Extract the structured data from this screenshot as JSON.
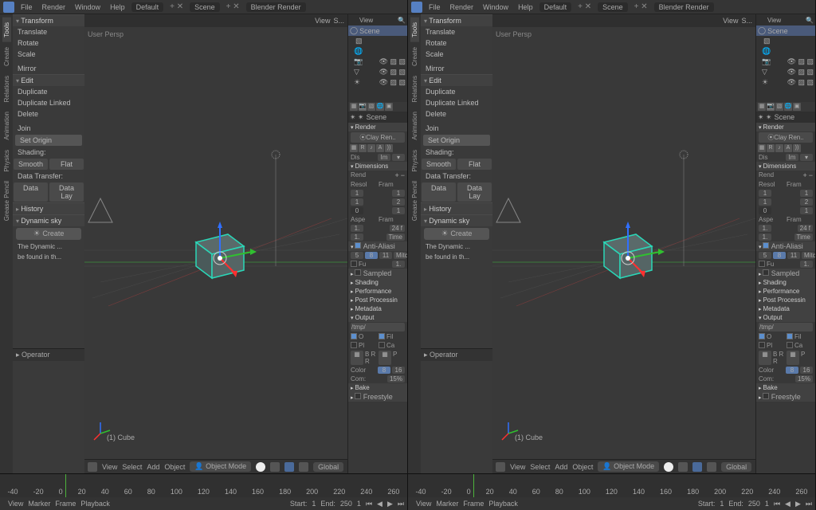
{
  "menubar": {
    "items": [
      "File",
      "Render",
      "Window",
      "Help"
    ],
    "layout": "Default",
    "scene": "Scene",
    "engine": "Blender Render"
  },
  "vtabs": [
    "Tools",
    "Create",
    "Relations",
    "Animation",
    "Physics",
    "Grease Pencil"
  ],
  "tool_panels": {
    "transform": {
      "title": "Transform",
      "items": [
        "Translate",
        "Rotate",
        "Scale",
        "",
        "Mirror"
      ]
    },
    "edit": {
      "title": "Edit",
      "items": [
        "Duplicate",
        "Duplicate Linked",
        "Delete",
        "",
        "Join"
      ],
      "setorigin": "Set Origin",
      "shading": "Shading:",
      "smooth": "Smooth",
      "flat": "Flat",
      "datatransfer": "Data Transfer:",
      "data": "Data",
      "datalay": "Data Lay"
    },
    "history": {
      "title": "History"
    },
    "dynsky": {
      "title": "Dynamic sky",
      "create": "Create",
      "note1": "The Dynamic ...",
      "note2": "be found in th..."
    }
  },
  "operator_title": "Operator",
  "viewport": {
    "persp": "User Persp",
    "objname": "(1) Cube"
  },
  "footer": {
    "view": "View",
    "select": "Select",
    "add": "Add",
    "object": "Object",
    "mode": "Object Mode",
    "orient": "Global"
  },
  "timeline": {
    "nums": [
      "-40",
      "-20",
      "0",
      "20",
      "40",
      "60",
      "80",
      "100",
      "120",
      "140",
      "160",
      "180",
      "200",
      "220",
      "240",
      "260"
    ],
    "labels": [
      "View",
      "Marker",
      "Frame",
      "Playback"
    ],
    "start": "Start:",
    "startv": "1",
    "end": "End:",
    "endv": "250",
    "cur": "1"
  },
  "outliner": {
    "hdr": "View",
    "items": [
      {
        "name": "Scene",
        "sel": true
      },
      {
        "name": "RenderLayers"
      },
      {
        "name": "World"
      },
      {
        "name": "Camera"
      },
      {
        "name": "Cube"
      },
      {
        "name": "Lamp"
      }
    ]
  },
  "props": {
    "scene": "Scene",
    "render": {
      "title": "Render",
      "clay": "⦿Clay Ren..",
      "display": "Dis",
      "dispv": "Im"
    },
    "dimensions": {
      "title": "Dimensions",
      "rend": "Rend",
      "resol": "Resol",
      "fram": "Fram",
      "rows": [
        [
          "1",
          "",
          "1"
        ],
        [
          "1",
          "",
          "2"
        ],
        [
          "0",
          "",
          "1"
        ]
      ],
      "aspe": "Aspe",
      "frate": "Fram",
      "a1": "1.",
      "f1": "24 f",
      "a2": "1.",
      "f2": "Time"
    },
    "aa": {
      "title": "Anti-Aliasi",
      "r1a": "5",
      "r1b": "8",
      "r1c": "11",
      "r1d": "Mitc",
      "fu": "Fu",
      "fuv": "1."
    },
    "sampled": "Sampled",
    "shading": "Shading",
    "perf": "Performance",
    "post": "Post Processin",
    "meta": "Metadata",
    "output": {
      "title": "Output",
      "path": "/tmp/",
      "o": "O",
      "fil": "Fil",
      "pl": "Pl",
      "ca": "Ca",
      "brr": "B  R R",
      "png": "P"
    },
    "color": {
      "lab": "Color",
      "v": "8",
      "v2": "16",
      "com": "Com:",
      "comv": "15%"
    },
    "bake": "Bake",
    "freestyle": "Freestyle"
  }
}
